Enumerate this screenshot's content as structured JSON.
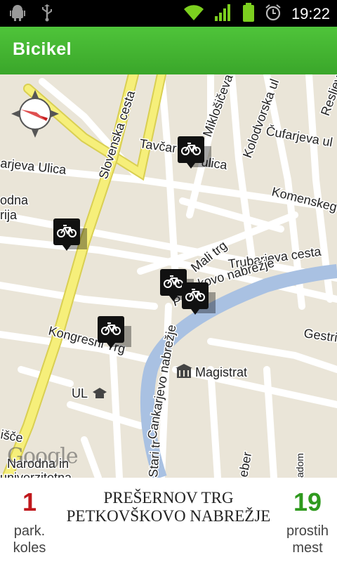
{
  "status_bar": {
    "time": "19:22",
    "icons": [
      "android-debug-icon",
      "usb-icon",
      "wifi-icon",
      "signal-icon",
      "battery-icon",
      "alarm-icon"
    ]
  },
  "app_bar": {
    "title": "Bicikel"
  },
  "map": {
    "street_labels": [
      "Slovenska cesta",
      "Miklošičeva",
      "Kolodvorska ul",
      "Resljev",
      "Čufarjeva ul",
      "Tavčar",
      "ulica",
      "arjeva Ulica",
      "odna",
      "rija",
      "Komenskeg",
      "Mali trg",
      "Trubarjeva cesta",
      "kovo nabrežje",
      "P",
      "Gestri",
      "Kongresni Trg",
      "Cankarjevo nabrežje",
      "Magistrat",
      "UL",
      "išče",
      "Stari tr",
      "Narodna in",
      "univerzitetna",
      "eber",
      "adom"
    ],
    "attribution": "Google",
    "colors": {
      "land": "#eae5d8",
      "road": "#ffffff",
      "main_road": "#f6ef7a",
      "river": "#a9c1e2"
    }
  },
  "station": {
    "bikes_count": "1",
    "bikes_label_line1": "park.",
    "bikes_label_line2": "koles",
    "name_line1": "PREŠERNOV TRG",
    "name_line2": "PETKOVŠKOVO NABREŽJE",
    "free_count": "19",
    "free_label_line1": "prostih",
    "free_label_line2": "mest",
    "colors": {
      "bikes": "#c0181c",
      "free": "#2f9a1e"
    }
  }
}
